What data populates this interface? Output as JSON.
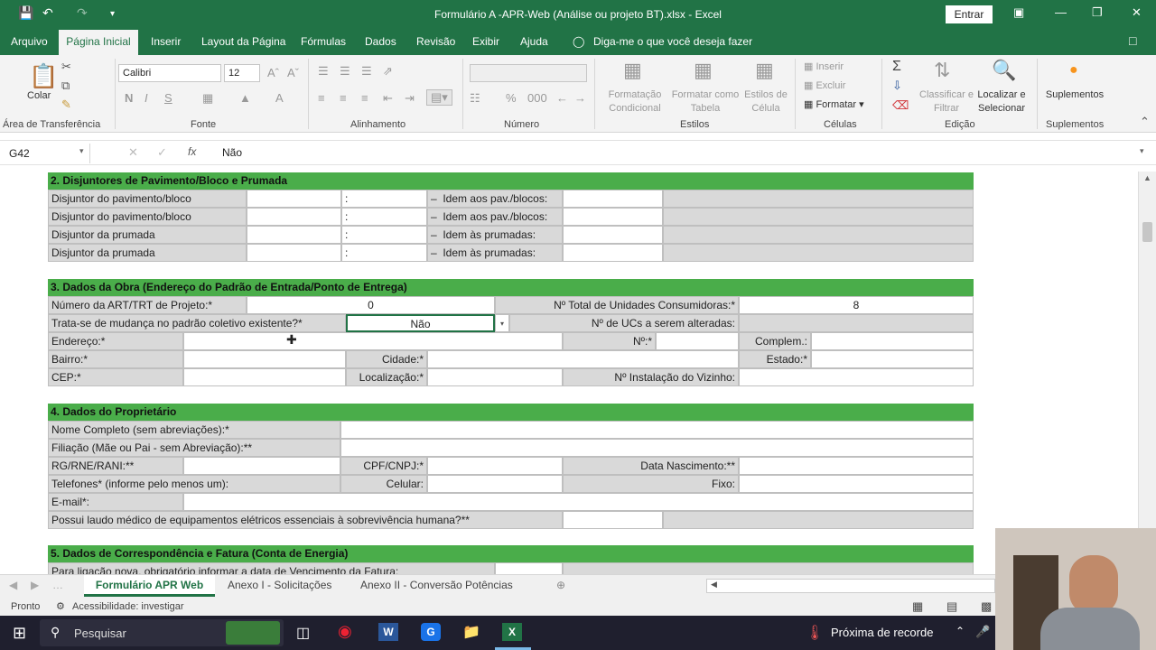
{
  "window": {
    "title": "Formulário A -APR-Web (Análise ou projeto BT).xlsx  -  Excel",
    "sign_in": "Entrar"
  },
  "menu": {
    "tabs": [
      "Arquivo",
      "Página Inicial",
      "Inserir",
      "Layout da Página",
      "Fórmulas",
      "Dados",
      "Revisão",
      "Exibir",
      "Ajuda"
    ],
    "tell_me": "Diga-me o que você deseja fazer"
  },
  "ribbon": {
    "paste_label": "Colar",
    "clipboard_group": "Área de Transferência",
    "font_group": "Fonte",
    "font_name": "Calibri",
    "font_size": "12",
    "bold": "N",
    "italic": "I",
    "underline": "S",
    "alignment_group": "Alinhamento",
    "number_group": "Número",
    "cond_format": "Formatação Condicional",
    "format_table": "Formatar como Tabela",
    "cell_styles": "Estilos de Célula",
    "styles_group": "Estilos",
    "insert": "Inserir",
    "delete": "Excluir",
    "format": "Formatar",
    "cells_group": "Células",
    "sort_filter": "Classificar e Filtrar",
    "find_select": "Localizar e Selecionar",
    "editing_group": "Edição",
    "addins": "Suplementos",
    "addins_group": "Suplementos"
  },
  "formula_bar": {
    "name_box": "G42",
    "fx": "fx",
    "value": "Não"
  },
  "sections": {
    "s2": {
      "title": "2. Disjuntores de Pavimento/Bloco e Prumada",
      "rows": [
        {
          "label": "Disjuntor do pavimento/bloco",
          "idem": "Idem aos pav./blocos:"
        },
        {
          "label": "Disjuntor do pavimento/bloco",
          "idem": "Idem aos pav./blocos:"
        },
        {
          "label": "Disjuntor da prumada",
          "idem": "Idem às prumadas:"
        },
        {
          "label": "Disjuntor da prumada",
          "idem": "Idem às prumadas:"
        }
      ]
    },
    "s3": {
      "title": "3. Dados da Obra (Endereço do Padrão de Entrada/Ponto de Entrega)",
      "art_label": "Número da ART/TRT de Projeto:*",
      "art_value": "0",
      "total_ucs_label": "Nº Total de Unidades Consumidoras:*",
      "total_ucs_value": "8",
      "mudanca_label": "Trata-se de mudança no padrão coletivo existente?*",
      "mudanca_value": "Não",
      "ucs_alteradas_label": "Nº de UCs a serem alteradas:",
      "endereco_label": "Endereço:*",
      "numero_label": "Nº:*",
      "complem_label": "Complem.:",
      "bairro_label": "Bairro:*",
      "cidade_label": "Cidade:*",
      "estado_label": "Estado:*",
      "cep_label": "CEP:*",
      "localizacao_label": "Localização:*",
      "vizinho_label": "Nº Instalação do Vizinho:"
    },
    "s4": {
      "title": "4. Dados do Proprietário",
      "nome_label": "Nome Completo (sem abreviações):*",
      "filiacao_label": "Filiação (Mãe ou Pai - sem Abreviação):**",
      "rg_label": "RG/RNE/RANI:**",
      "cpf_label": "CPF/CNPJ:*",
      "nascimento_label": "Data Nascimento:**",
      "telefones_label": "Telefones* (informe pelo menos um):",
      "celular_label": "Celular:",
      "fixo_label": "Fixo:",
      "email_label": "E-mail*:",
      "laudo_label": "Possui laudo médico de equipamentos elétricos essenciais à sobrevivência humana?**"
    },
    "s5": {
      "title": "5. Dados de Correspondência e Fatura (Conta de Energia)",
      "row1": "Para ligação nova, obrigatório informar a data de Vencimento da Fatura:"
    }
  },
  "sheets": [
    "Formulário APR Web",
    "Anexo I - Solicitações",
    "Anexo II - Conversão Potências"
  ],
  "status": {
    "ready": "Pronto",
    "accessibility": "Acessibilidade: investigar"
  },
  "taskbar": {
    "search": "Pesquisar",
    "notification": "Próxima de recorde"
  },
  "colors": {
    "excel_green": "#217346",
    "section_header": "#4aad4a",
    "gray_cell": "#d9d9d9"
  }
}
